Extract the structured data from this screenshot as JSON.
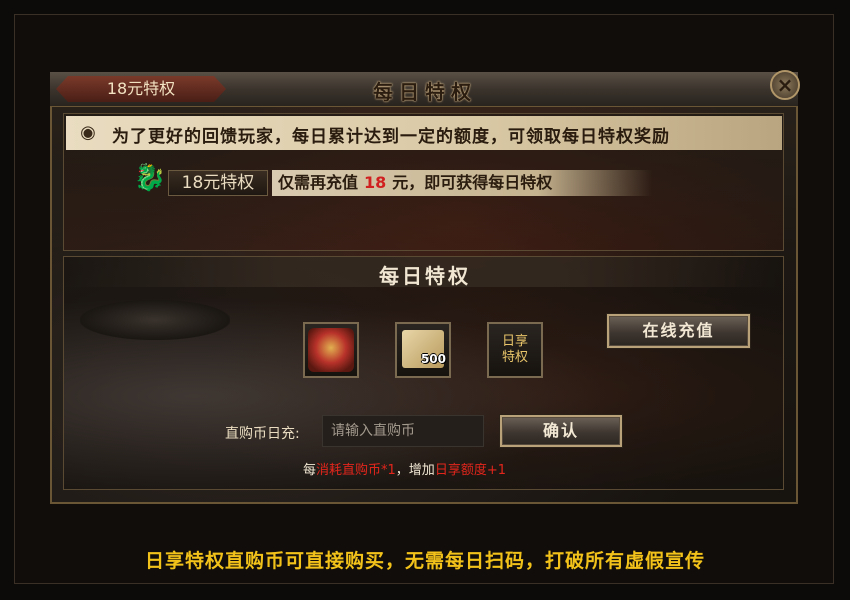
{
  "window": {
    "title": "每日特权",
    "tab_label": "18元特权",
    "close_icon": "×"
  },
  "info": {
    "notice_icon": "eye-icon",
    "notice_text": "为了更好的回馈玩家，每日累计达到一定的额度，可领取每日特权奖励",
    "badge_label": "18元特权",
    "recharge_prefix": "仅需再充值",
    "recharge_amount": "18",
    "recharge_suffix": "元，即可获得每日特权"
  },
  "privilege": {
    "title": "每日特权",
    "rewards": [
      {
        "name": "treasure-chest",
        "label": ""
      },
      {
        "name": "coupon",
        "quantity": "500"
      },
      {
        "name": "daily-privilege",
        "label": "日享\n特权"
      }
    ],
    "online_recharge_label": "在线充值",
    "input_label": "直购币日充:",
    "input_placeholder": "请输入直购币",
    "confirm_label": "确认",
    "rule_prefix": "每",
    "rule_cost": "消耗直购币*1",
    "rule_mid": "，增加",
    "rule_gain": "日享额度+1"
  },
  "footer": {
    "slogan": "日享特权直购币可直接购买，无需每日扫码，打破所有虚假宣传"
  },
  "colors": {
    "gold": "#f2c21a",
    "red": "#e2261c",
    "frame": "#6a5535"
  }
}
